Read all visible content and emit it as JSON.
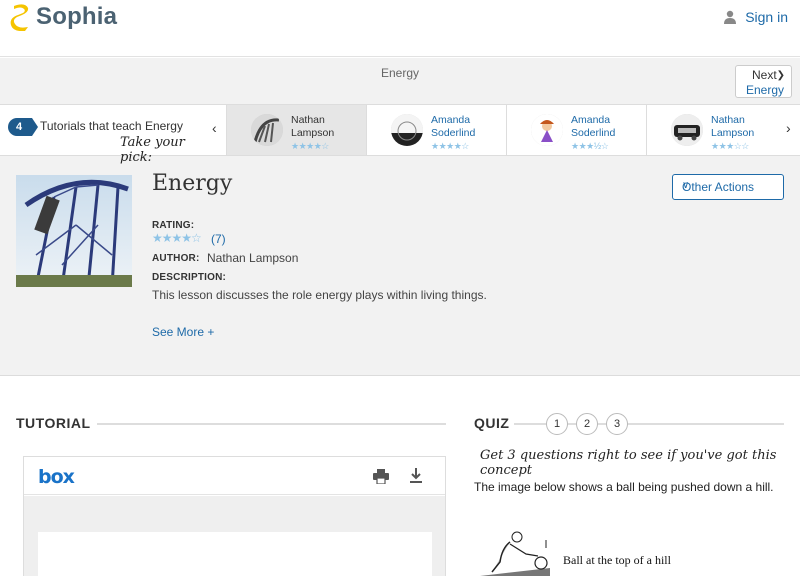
{
  "header": {
    "logo_text": "Sophia",
    "signin_label": "Sign in"
  },
  "concept": {
    "title": "Energy",
    "next_label": "Next",
    "next_subject": "Energy"
  },
  "tutorials_strip": {
    "count": "4",
    "intro": "Tutorials that teach Energy",
    "take_pick": "Take your pick:",
    "cards": [
      {
        "name_line1": "Nathan",
        "name_line2": "Lampson",
        "stars": "★★★★☆",
        "active": true
      },
      {
        "name_line1": "Amanda",
        "name_line2": "Soderlind",
        "stars": "★★★★☆",
        "active": false
      },
      {
        "name_line1": "Amanda",
        "name_line2": "Soderlind",
        "stars": "★★★½☆",
        "active": false
      },
      {
        "name_line1": "Nathan",
        "name_line2": "Lampson",
        "stars": "★★★☆☆",
        "active": false
      }
    ]
  },
  "lesson": {
    "title": "Energy",
    "other_actions_label": "Other Actions",
    "rating_label": "RATING:",
    "rating_stars": "★★★★☆",
    "rating_count": "(7)",
    "author_label": "AUTHOR:",
    "author": "Nathan Lampson",
    "description_label": "DESCRIPTION:",
    "description": "This lesson discusses the role energy plays within living things.",
    "see_more": "See More +"
  },
  "tutorial_section": {
    "title": "TUTORIAL",
    "viewer_logo": "box"
  },
  "quiz_section": {
    "title": "QUIZ",
    "numbers": [
      "1",
      "2",
      "3"
    ],
    "hint": "Get 3 questions right to see if you've got this concept",
    "question": "The image below shows a ball being pushed down a hill.",
    "image_caption": "Ball at the top of a hill"
  },
  "colors": {
    "brand_yellow": "#f5c400",
    "link_blue": "#1e6aa8",
    "star_blue": "#8ec3e6"
  }
}
